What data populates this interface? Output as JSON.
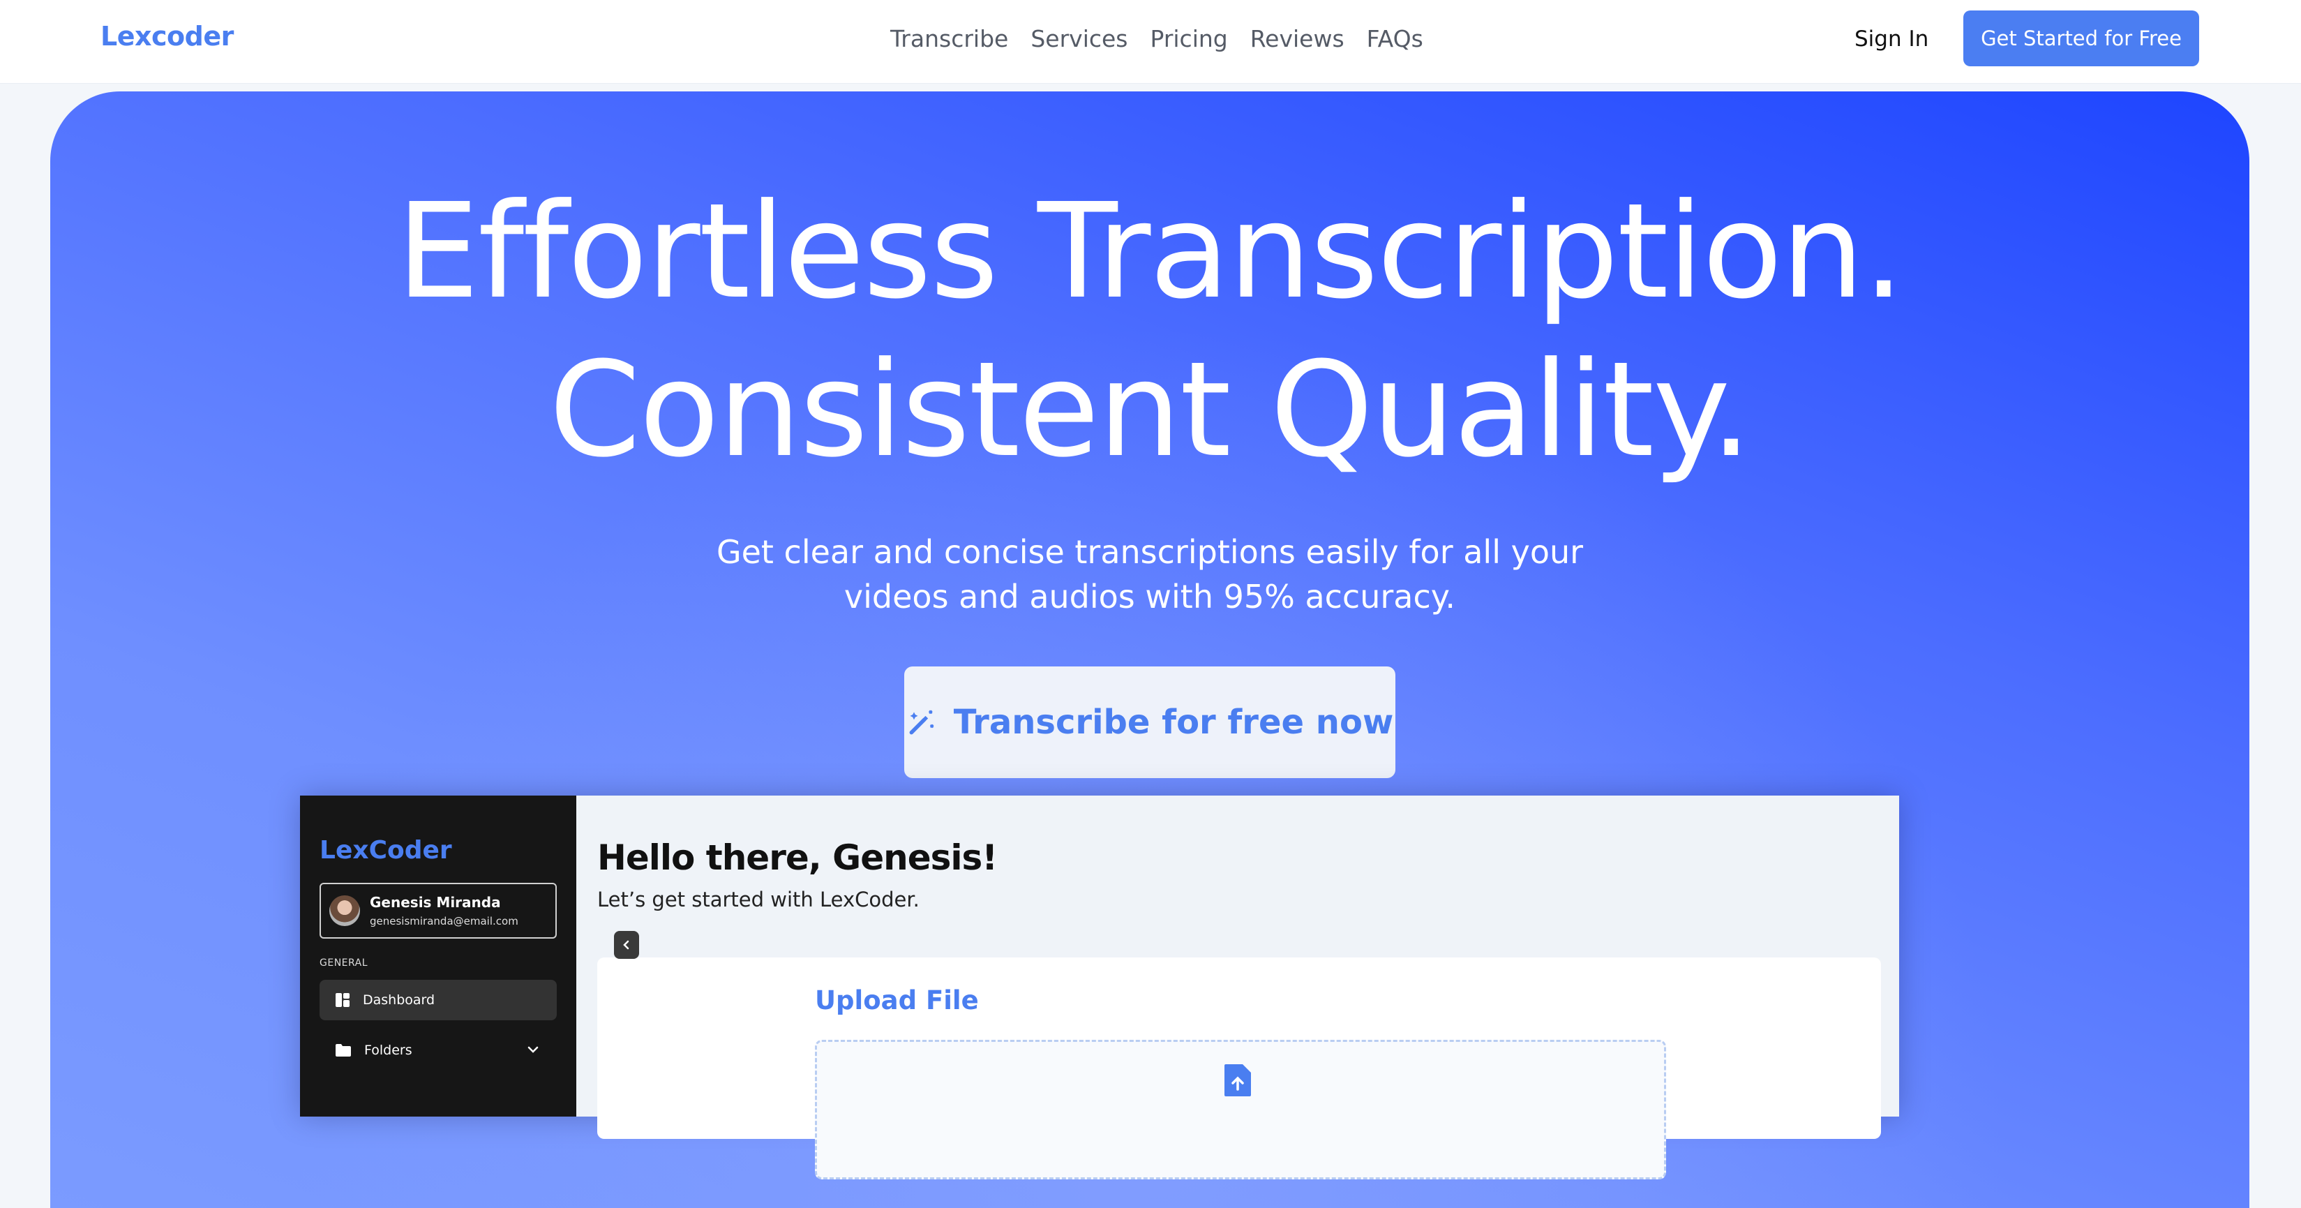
{
  "nav": {
    "logo": "Lexcoder",
    "links": [
      "Transcribe",
      "Services",
      "Pricing",
      "Reviews",
      "FAQs"
    ],
    "signin": "Sign In",
    "cta": "Get Started for Free"
  },
  "hero": {
    "title_line1": "Effortless Transcription.",
    "title_line2": "Consistent Quality.",
    "subtitle": "Get clear and concise transcriptions easily for all your videos and audios with 95% accuracy.",
    "cta": "Transcribe for free now",
    "cta_icon": "magic-wand-icon"
  },
  "app_preview": {
    "sidebar": {
      "logo": "LexCoder",
      "user_name": "Genesis Miranda",
      "user_email": "genesismiranda@email.com",
      "section_label": "GENERAL",
      "items": [
        {
          "label": "Dashboard",
          "icon": "dashboard-icon",
          "active": true
        },
        {
          "label": "Folders",
          "icon": "folder-icon",
          "active": false
        }
      ]
    },
    "main": {
      "greeting": "Hello there, Genesis!",
      "greeting_sub": "Let’s get started with LexCoder.",
      "upload_title": "Upload File",
      "upload_icon": "file-upload-icon"
    }
  },
  "colors": {
    "brand": "#4a7ef0",
    "hero_gradient_top": "#1e45ff",
    "hero_gradient_bottom": "#7b9bff",
    "sidebar_bg": "#161616"
  }
}
